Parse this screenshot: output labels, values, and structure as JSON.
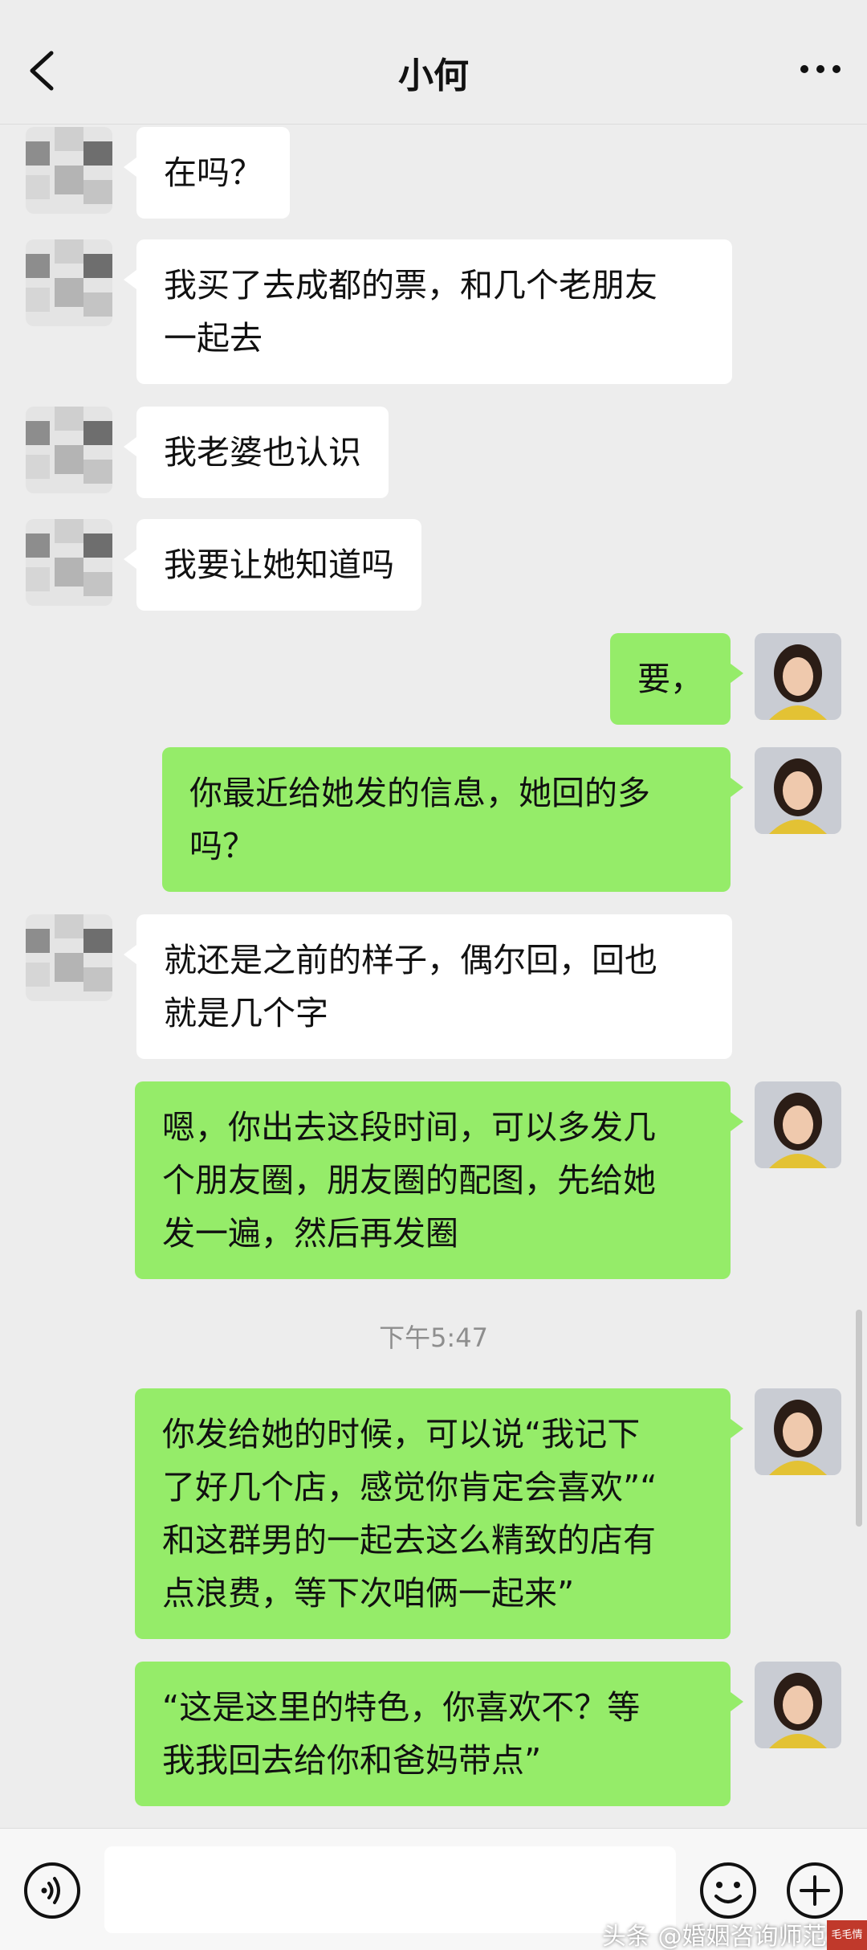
{
  "header": {
    "title": "小何"
  },
  "messages": [
    {
      "side": "left",
      "text": "在吗？"
    },
    {
      "side": "left",
      "text": "我买了去成都的票，和几个老朋友\n一起去"
    },
    {
      "side": "left",
      "text": "我老婆也认识"
    },
    {
      "side": "left",
      "text": "我要让她知道吗"
    },
    {
      "side": "right",
      "text": "要，"
    },
    {
      "side": "right",
      "text": "你最近给她发的信息，她回的多\n吗？"
    },
    {
      "side": "left",
      "text": "就还是之前的样子，偶尔回，回也\n就是几个字"
    },
    {
      "side": "right",
      "text": "嗯，你出去这段时间，可以多发几\n个朋友圈，朋友圈的配图，先给她\n发一遍，然后再发圈"
    },
    {
      "side": "right",
      "text": "你发给她的时候，可以说“我记下\n了好几个店，感觉你肯定会喜欢”“\n和这群男的一起去这么精致的店有\n点浪费，等下次咱俩一起来”"
    },
    {
      "side": "right",
      "text": "“这是这里的特色，你喜欢不？等\n我我回去给你和爸妈带点”"
    }
  ],
  "timestamp": "下午5:47",
  "footer": {
    "input_value": ""
  },
  "watermark": "头条 @婚姻咨询师范焕娟",
  "stamp_text": "毛毛情感",
  "colors": {
    "background": "#ededed",
    "incoming_bubble": "#ffffff",
    "outgoing_bubble": "#95ec69"
  },
  "icons": [
    "back-arrow-icon",
    "more-dots-icon",
    "voice-icon",
    "emoji-icon",
    "plus-icon"
  ]
}
